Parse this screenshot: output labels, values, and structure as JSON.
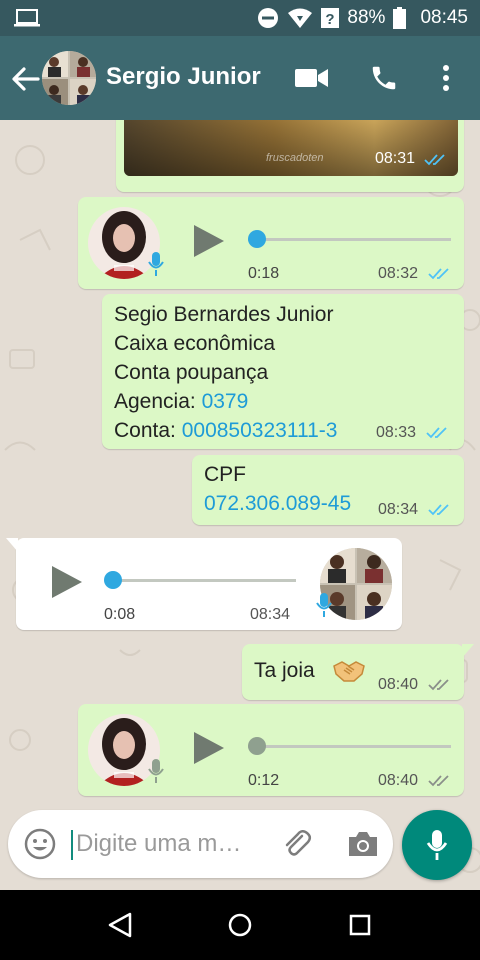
{
  "status_bar": {
    "battery": "88%",
    "time": "08:45",
    "icons": [
      "laptop-icon",
      "do-not-disturb-icon",
      "wifi-icon",
      "no-signal-icon",
      "battery-icon"
    ]
  },
  "header": {
    "contact_name": "Sergio Junior",
    "icons": [
      "back-arrow-icon",
      "video-call-icon",
      "phone-call-icon",
      "more-vert-icon"
    ]
  },
  "messages": [
    {
      "type": "image",
      "direction": "out",
      "watermark": "fruscadoten",
      "time": "08:31",
      "status": "read"
    },
    {
      "type": "voice",
      "direction": "out",
      "duration": "0:18",
      "time": "08:32",
      "status": "read",
      "progress": 0
    },
    {
      "type": "text",
      "direction": "out",
      "lines": {
        "name": "Segio Bernardes Junior",
        "bank": "Caixa econômica",
        "account_type": "Conta poupança",
        "agency_label": "Agencia: ",
        "agency_value": "0379",
        "account_label": "Conta: ",
        "account_value": "000850323111-3"
      },
      "time": "08:33",
      "status": "read"
    },
    {
      "type": "text",
      "direction": "out",
      "label": "CPF",
      "value": "072.306.089-45",
      "time": "08:34",
      "status": "read"
    },
    {
      "type": "voice",
      "direction": "in",
      "duration": "0:08",
      "time": "08:34",
      "progress": 0
    },
    {
      "type": "text",
      "direction": "out",
      "text": "Ta joia",
      "emoji": "handshake-icon",
      "time": "08:40",
      "status": "delivered"
    },
    {
      "type": "voice",
      "direction": "out",
      "duration": "0:12",
      "time": "08:40",
      "status": "delivered",
      "progress": 0
    }
  ],
  "composer": {
    "placeholder": "Digite uma m…",
    "icons": [
      "emoji-icon",
      "attach-icon",
      "camera-icon",
      "mic-icon"
    ]
  },
  "colors": {
    "header": "#3d6970",
    "status_bar": "#36585f",
    "outgoing_bubble": "#dcf8c6",
    "incoming_bubble": "#ffffff",
    "read_ticks": "#4fc3f7",
    "link": "#1e9bd7",
    "accent": "#00897b"
  }
}
